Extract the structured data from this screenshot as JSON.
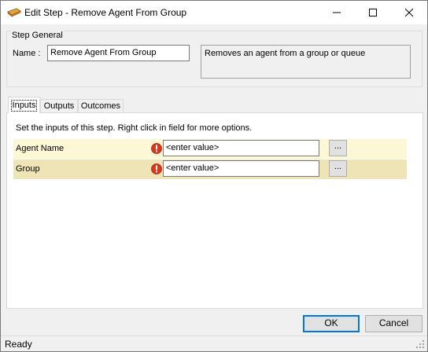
{
  "window": {
    "title": "Edit Step - Remove Agent From Group",
    "icon": "step-icon",
    "controls": {
      "minimize": "minimize-icon",
      "maximize": "maximize-icon",
      "close": "close-icon"
    }
  },
  "step_general": {
    "legend": "Step General",
    "name_label": "Name :",
    "name_value": "Remove Agent From Group",
    "description": "Removes an agent from a group or queue"
  },
  "tabs": [
    {
      "label": "Inputs",
      "active": true
    },
    {
      "label": "Outputs",
      "active": false
    },
    {
      "label": "Outcomes",
      "active": false
    }
  ],
  "inputs_panel": {
    "help_text": "Set the inputs of this step.  Right click in field for more options.",
    "rows": [
      {
        "label": "Agent Name",
        "value": "<enter value>",
        "icon": "error-icon",
        "button": "..."
      },
      {
        "label": "Group",
        "value": "<enter value>",
        "icon": "error-icon",
        "button": "..."
      }
    ]
  },
  "buttons": {
    "ok": "OK",
    "cancel": "Cancel"
  },
  "status": {
    "text": "Ready"
  },
  "colors": {
    "row_light": "#fcf7d5",
    "row_dark": "#eee4b5",
    "error_red": "#d9381e",
    "focus_blue": "#0078d7"
  }
}
